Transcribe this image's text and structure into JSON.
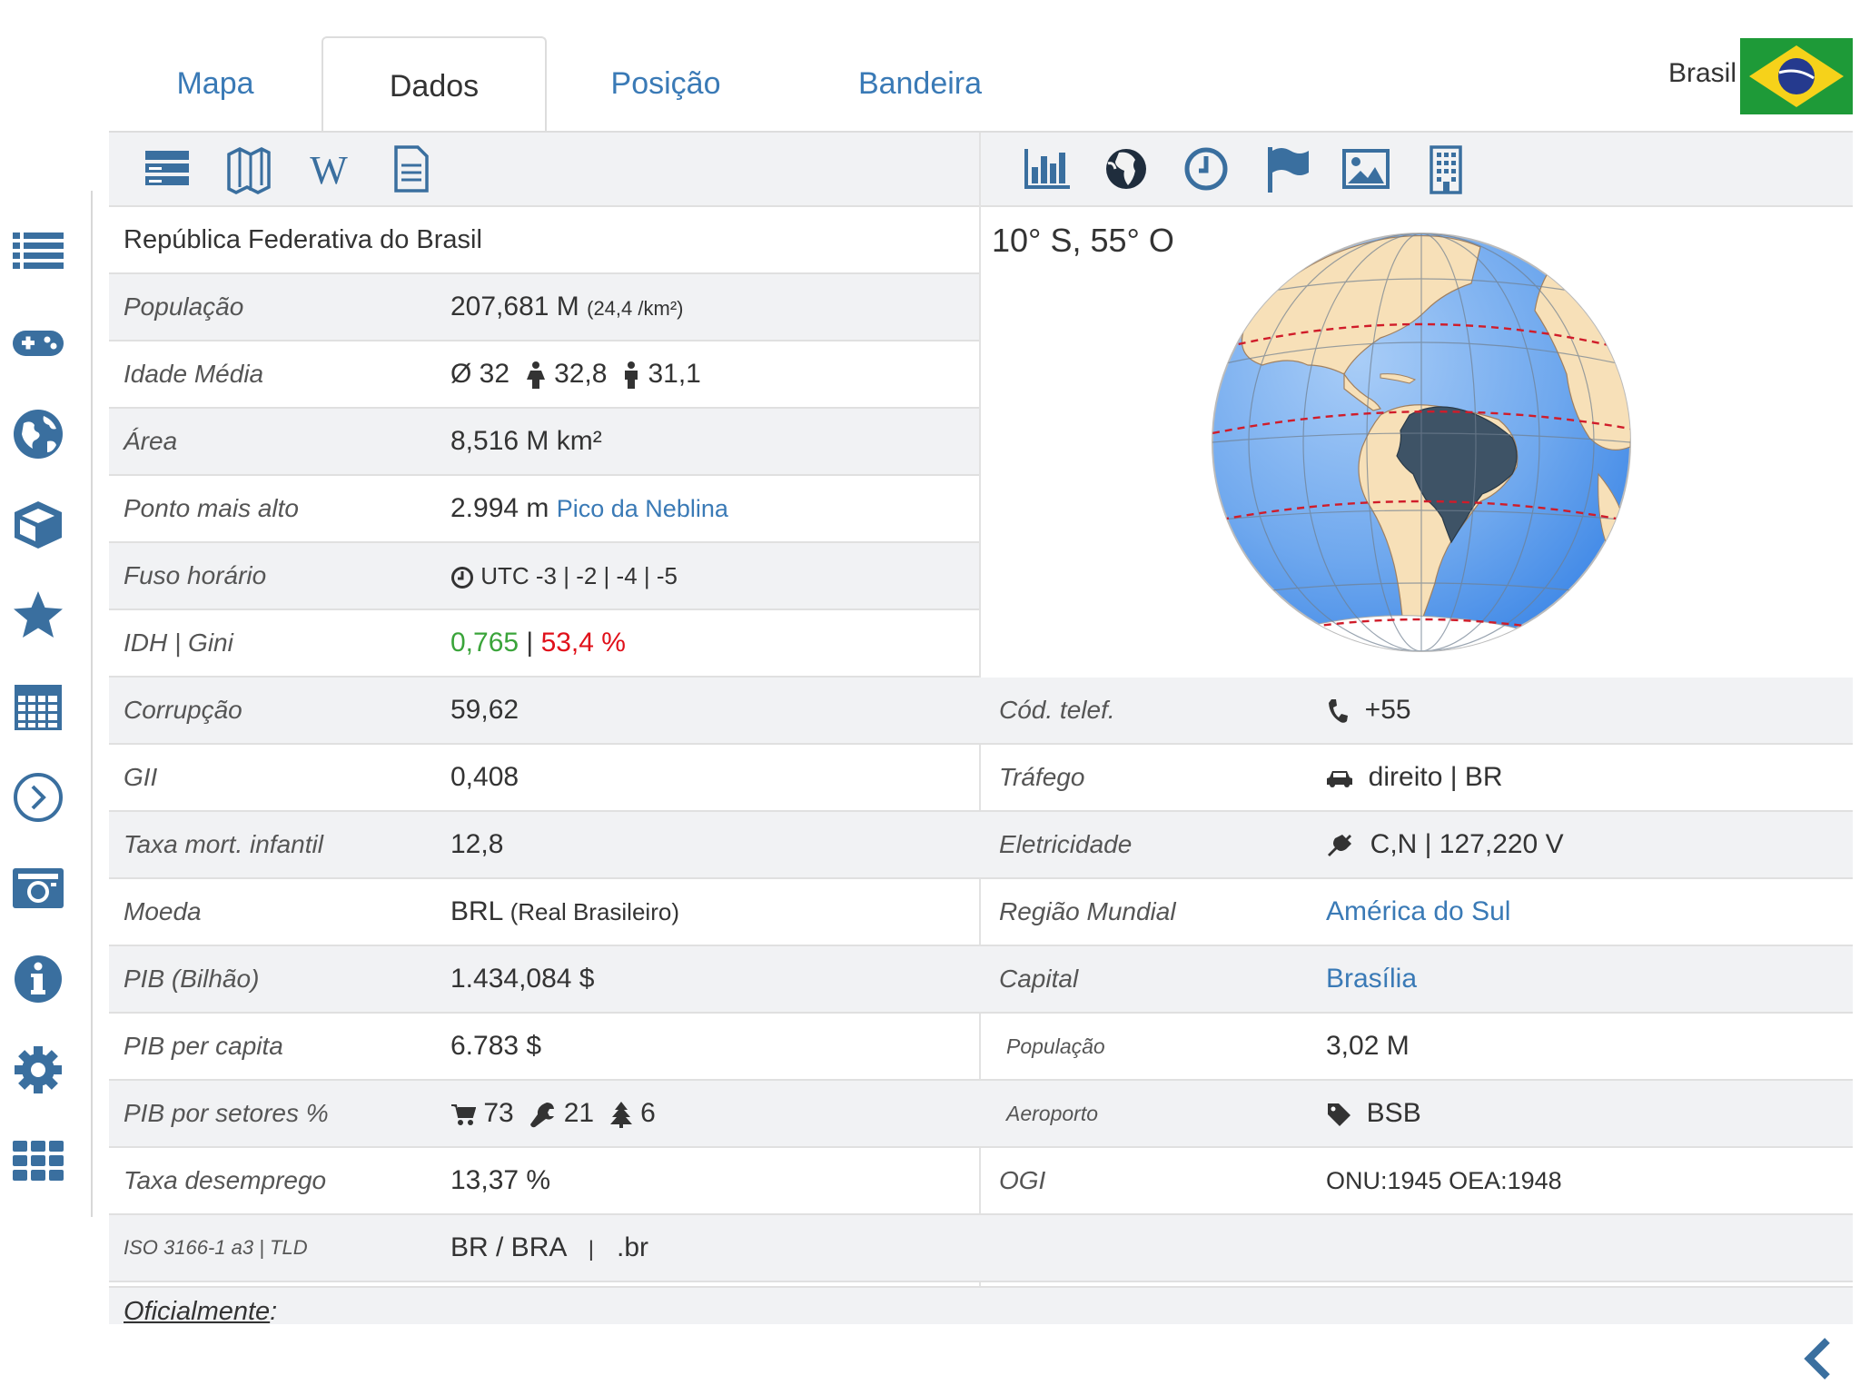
{
  "tabs": [
    {
      "label": "Mapa"
    },
    {
      "label": "Dados"
    },
    {
      "label": "Posição"
    },
    {
      "label": "Bandeira"
    }
  ],
  "country": {
    "name": "Brasil"
  },
  "colors": {
    "accent": "#3a7ab6",
    "icon": "#3a6f9f",
    "brazil_fill": "#3e5366"
  },
  "sidebar_icons": [
    "list-icon",
    "gamepad-icon",
    "globe-icon",
    "cube-icon",
    "star-icon",
    "calendar-icon",
    "chevron-circle-icon",
    "camera-icon",
    "info-icon",
    "gear-icon",
    "grid-icon"
  ],
  "toolbar_icons": [
    "table-icon",
    "map-icon",
    "wikipedia-icon",
    "document-icon",
    "bar-chart-icon",
    "globe-africa-icon",
    "clock-icon",
    "flag-icon",
    "image-icon",
    "building-icon"
  ],
  "globe": {
    "coordinates": "10° S, 55° O"
  },
  "official_name": "República Federativa do Brasil",
  "left_rows": {
    "populacao": {
      "label": "População",
      "value": "207,681 M",
      "density": "(24,4 /km²)"
    },
    "idade": {
      "label": "Idade Média",
      "all": "Ø 32",
      "female": "32,8",
      "male": "31,1"
    },
    "area": {
      "label": "Área",
      "value": "8,516 M km²"
    },
    "ponto": {
      "label": "Ponto mais alto",
      "value": "2.994 m",
      "link": "Pico da Neblina"
    },
    "fuso": {
      "label": "Fuso horário",
      "value": "UTC -3 | -2 | -4 | -5"
    },
    "idh": {
      "label": "IDH | Gini",
      "idh": "0,765",
      "sep": "|",
      "gini": "53,4 %"
    },
    "corrupcao": {
      "label": "Corrupção",
      "value": "59,62"
    },
    "gii": {
      "label": "GII",
      "value": "0,408"
    },
    "mortalidade": {
      "label": "Taxa mort. infantil",
      "value": "12,8"
    },
    "moeda": {
      "label": "Moeda",
      "code": "BRL",
      "name": "(Real Brasileiro)"
    },
    "pib": {
      "label": "PIB (Bilhão)",
      "value": "1.434,084 $"
    },
    "pib_pc": {
      "label": "PIB per capita",
      "value": "6.783 $"
    },
    "setores": {
      "label": "PIB por setores %",
      "services": "73",
      "industry": "21",
      "agriculture": "6"
    },
    "desemprego": {
      "label": "Taxa desemprego",
      "value": "13,37 %"
    },
    "iso": {
      "label": "ISO 3166-1 a3 | TLD",
      "value": "BR / BRA",
      "sep": "|",
      "tld": ".br"
    }
  },
  "right_rows": {
    "telef": {
      "label": "Cód. telef.",
      "value": "+55"
    },
    "trafego": {
      "label": "Tráfego",
      "value": "direito | BR"
    },
    "eletricidade": {
      "label": "Eletricidade",
      "value": "C,N | 127,220 V"
    },
    "regiao": {
      "label": "Região Mundial",
      "value": "América do Sul"
    },
    "capital": {
      "label": "Capital",
      "value": "Brasília"
    },
    "cap_pop": {
      "label": "População",
      "value": "3,02 M"
    },
    "aeroporto": {
      "label": "Aeroporto",
      "value": "BSB"
    },
    "ogi": {
      "label": "OGI",
      "value": "ONU:1945  OEA:1948"
    }
  },
  "footer": {
    "official_label": "Oficialmente",
    "official_colon": ":"
  }
}
